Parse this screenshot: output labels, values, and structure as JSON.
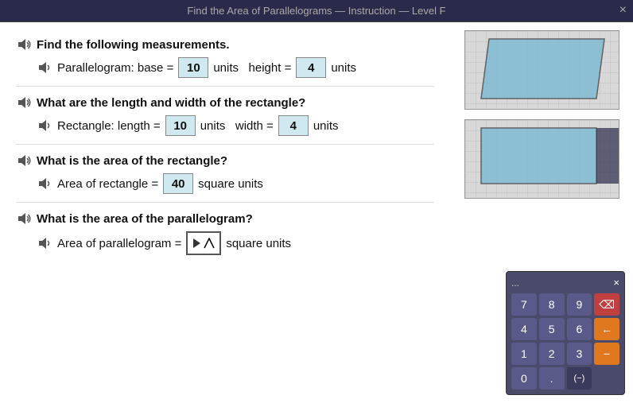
{
  "header": {
    "title": "Find the Area of Parallelograms — Instruction — Level F",
    "close_label": "×"
  },
  "sections": [
    {
      "id": "s1",
      "question": "Find the following measurements.",
      "answer_line": {
        "prefix": "Parallelogram: base =",
        "base_value": "10",
        "mid_text": "units   height =",
        "height_value": "4",
        "suffix": "units"
      }
    },
    {
      "id": "s2",
      "question": "What are the length and width of the rectangle?",
      "answer_line": {
        "prefix": "Rectangle: length =",
        "length_value": "10",
        "mid_text": "units   width =",
        "width_value": "4",
        "suffix": "units"
      }
    },
    {
      "id": "s3",
      "question": "What is the area of the rectangle?",
      "answer_line": {
        "prefix": "Area of rectangle =",
        "area_value": "40",
        "suffix": "square units"
      }
    },
    {
      "id": "s4",
      "question": "What is the area of the parallelogram?",
      "answer_line": {
        "prefix": "Area of parallelogram =",
        "suffix": "square units"
      }
    }
  ],
  "calculator": {
    "dots": "...",
    "close_label": "×",
    "buttons": [
      {
        "label": "7",
        "type": "normal"
      },
      {
        "label": "8",
        "type": "normal"
      },
      {
        "label": "9",
        "type": "normal"
      },
      {
        "label": "⌫",
        "type": "red"
      },
      {
        "label": "4",
        "type": "normal"
      },
      {
        "label": "5",
        "type": "normal"
      },
      {
        "label": "6",
        "type": "normal"
      },
      {
        "label": "←",
        "type": "orange"
      },
      {
        "label": "1",
        "type": "normal"
      },
      {
        "label": "2",
        "type": "normal"
      },
      {
        "label": "3",
        "type": "normal"
      },
      {
        "label": "−",
        "type": "orange"
      },
      {
        "label": "0",
        "type": "normal"
      },
      {
        "label": ".",
        "type": "normal"
      },
      {
        "label": "(−)",
        "type": "dark"
      }
    ]
  }
}
